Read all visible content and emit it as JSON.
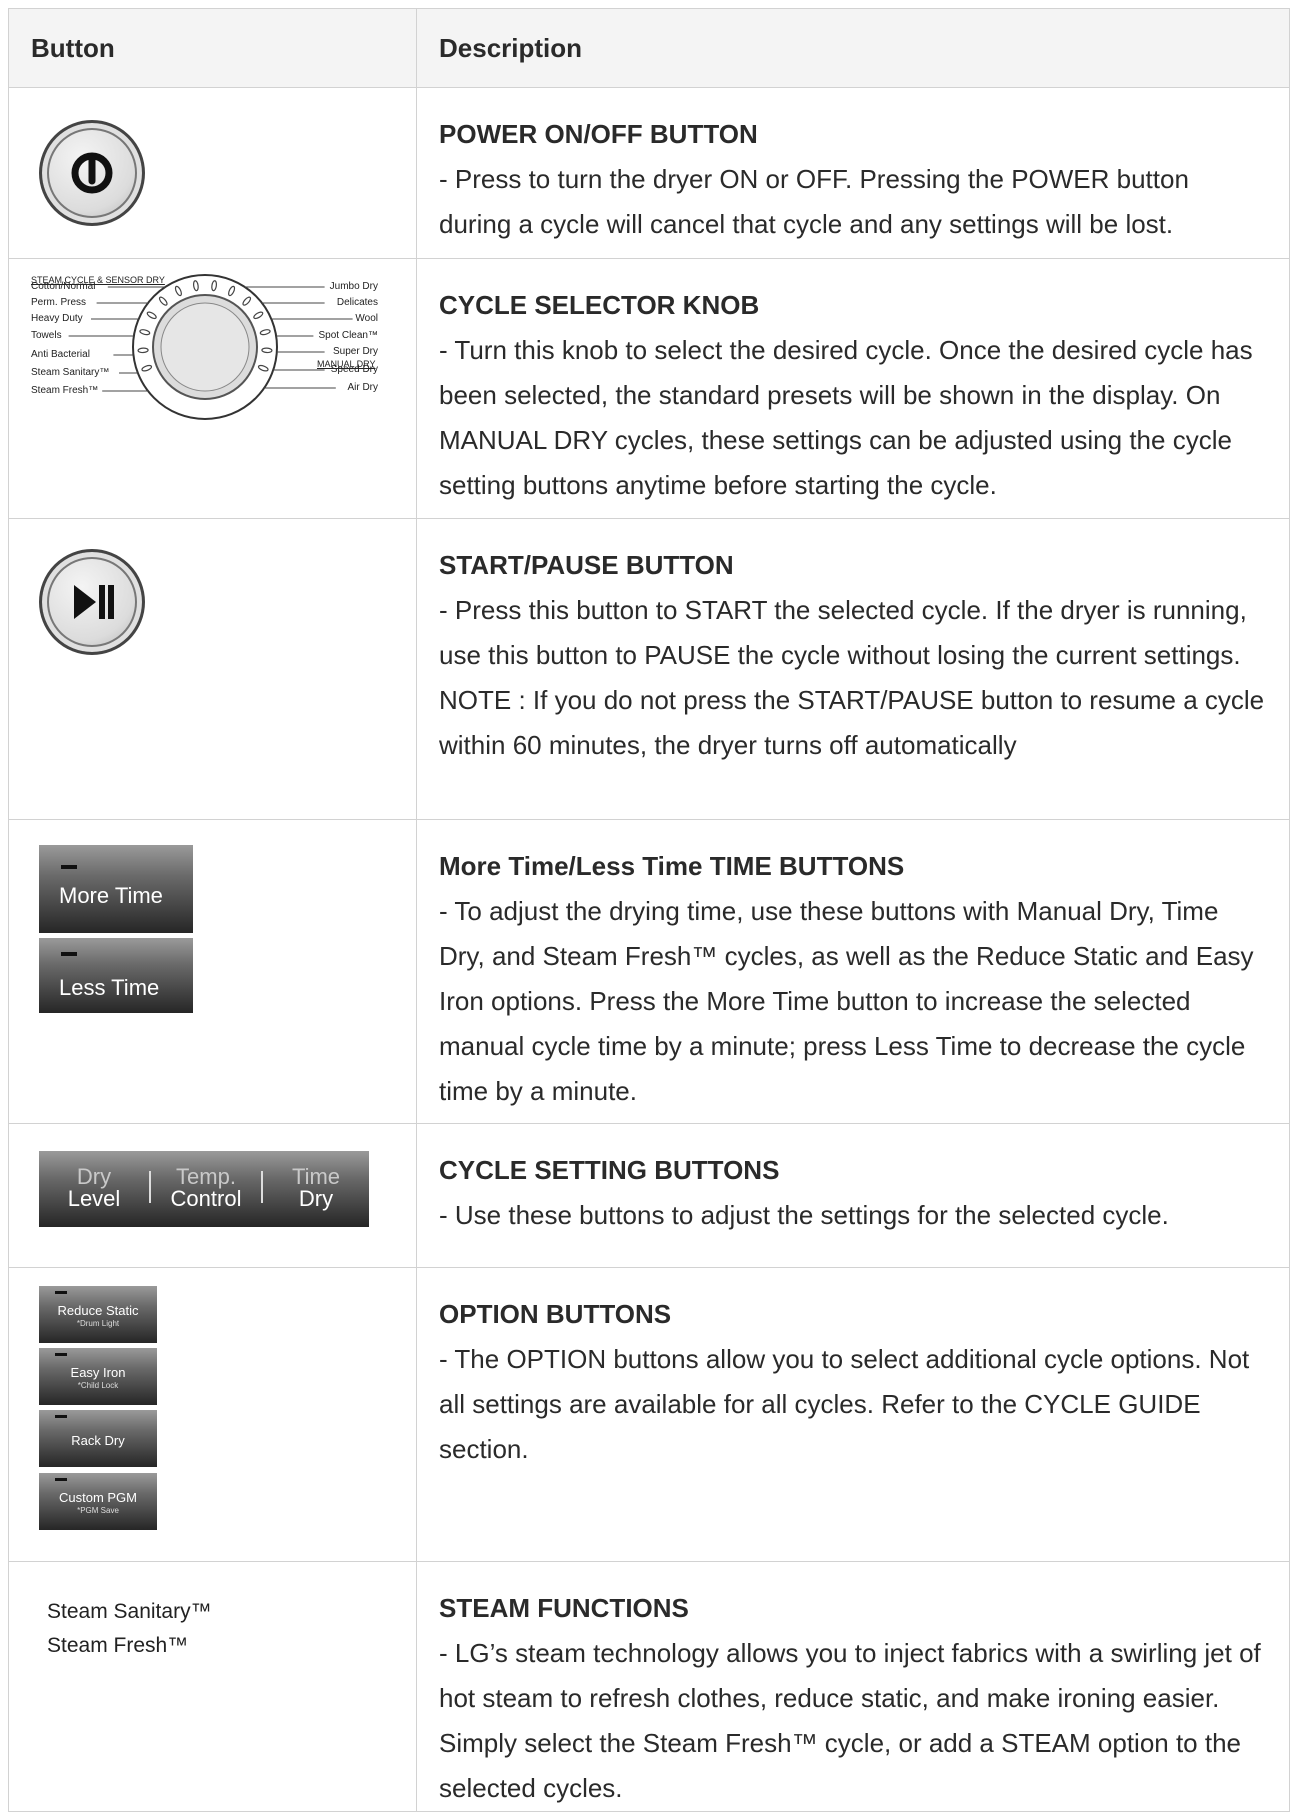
{
  "table": {
    "header": {
      "button": "Button",
      "description": "Description"
    },
    "rows": [
      {
        "title": "POWER ON/OFF BUTTON",
        "text": "- Press to turn the dryer ON or OFF. Pressing the POWER button during a cycle will cancel that cycle and any settings will be lost."
      },
      {
        "title": "CYCLE SELECTOR KNOB",
        "text": "- Turn this knob to select the desired cycle. Once the desired cycle has been selected, the standard presets will be shown in the display. On MANUAL DRY cycles, these settings can be adjusted using the cycle setting buttons anytime before starting the cycle.",
        "dial": {
          "header_left": "STEAM CYCLE & SENSOR DRY",
          "header_right": "MANUAL DRY",
          "left_labels": [
            "Cotton/Normal",
            "Perm. Press",
            "Heavy Duty",
            "Towels",
            "Anti Bacterial",
            "Steam Sanitary™",
            "Steam Fresh™"
          ],
          "right_labels": [
            "Jumbo Dry",
            "Delicates",
            "Wool",
            "Spot Clean™",
            "Super Dry",
            "Speed Dry",
            "Air Dry"
          ]
        }
      },
      {
        "title": "START/PAUSE BUTTON",
        "text": "- Press this button to START the selected cycle. If the dryer is running, use this button to PAUSE the cycle without losing the current settings. NOTE : If you do not press the START/PAUSE button to resume a cycle within 60 minutes, the dryer turns off automatically"
      },
      {
        "title": "More Time/Less Time TIME BUTTONS",
        "text": "- To adjust the drying time, use these buttons with Manual Dry, Time Dry, and Steam Fresh™ cycles, as well as the Reduce Static and Easy Iron options. Press the More Time button to increase the selected manual cycle time by a minute; press Less Time to decrease the cycle time by a minute.",
        "buttons": [
          "More Time",
          "Less Time"
        ]
      },
      {
        "title": "CYCLE SETTING BUTTONS",
        "text": "- Use these buttons to adjust the settings for the selected cycle.",
        "segments": [
          {
            "top": "Dry",
            "bottom": "Level"
          },
          {
            "top": "Temp.",
            "bottom": "Control"
          },
          {
            "top": "Time",
            "bottom": "Dry"
          }
        ]
      },
      {
        "title": "OPTION BUTTONS",
        "text": "- The OPTION buttons allow you to select additional cycle options. Not all settings are available for all cycles. Refer to the CYCLE GUIDE section.",
        "options": [
          {
            "label": "Reduce Static",
            "sub": "*Drum Light"
          },
          {
            "label": "Easy Iron",
            "sub": "*Child Lock"
          },
          {
            "label": "Rack Dry",
            "sub": ""
          },
          {
            "label": "Custom PGM",
            "sub": "*PGM Save"
          }
        ]
      },
      {
        "title": "STEAM FUNCTIONS",
        "text": "- LG’s steam technology allows you to inject fabrics with a swirling jet of hot steam to refresh clothes, reduce static, and make ironing easier. Simply select the Steam Fresh™ cycle, or add a STEAM option to the selected cycles.",
        "labels": [
          "Steam Sanitary™",
          "Steam Fresh™"
        ]
      }
    ]
  }
}
